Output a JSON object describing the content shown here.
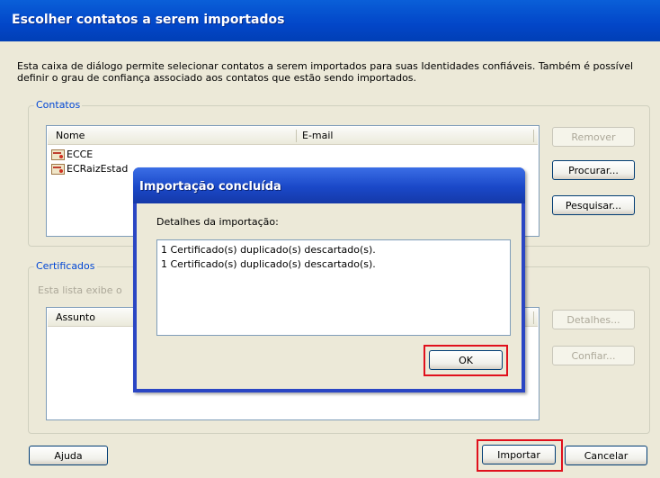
{
  "window": {
    "title": "Escolher contatos a serem importados",
    "intro": "Esta caixa de diálogo permite selecionar contatos a serem importados para suas Identidades confiáveis. Também é possível definir o grau de confiança associado aos contatos que estão sendo importados."
  },
  "contacts": {
    "group_label": "Contatos",
    "columns": [
      "Nome",
      "E-mail"
    ],
    "rows": [
      {
        "name": "ECCE",
        "email": ""
      },
      {
        "name": "ECRaizEstad",
        "email": ""
      }
    ],
    "buttons": {
      "remove": "Remover",
      "browse": "Procurar...",
      "search": "Pesquisar..."
    }
  },
  "certificates": {
    "group_label": "Certificados",
    "description": "Esta lista exibe o",
    "columns": [
      "Assunto"
    ],
    "buttons": {
      "details": "Detalhes...",
      "trust": "Confiar..."
    }
  },
  "footer": {
    "help": "Ajuda",
    "import": "Importar",
    "cancel": "Cancelar"
  },
  "import_dialog": {
    "title": "Importação concluída",
    "details_label": "Detalhes da importação:",
    "messages": [
      "1 Certificado(s) duplicado(s) descartado(s).",
      "1 Certificado(s) duplicado(s) descartado(s)."
    ],
    "ok": "OK"
  },
  "colors": {
    "highlight": "#e0101c",
    "title_bar": "#0a5fd8",
    "group_label": "#0046d5"
  }
}
